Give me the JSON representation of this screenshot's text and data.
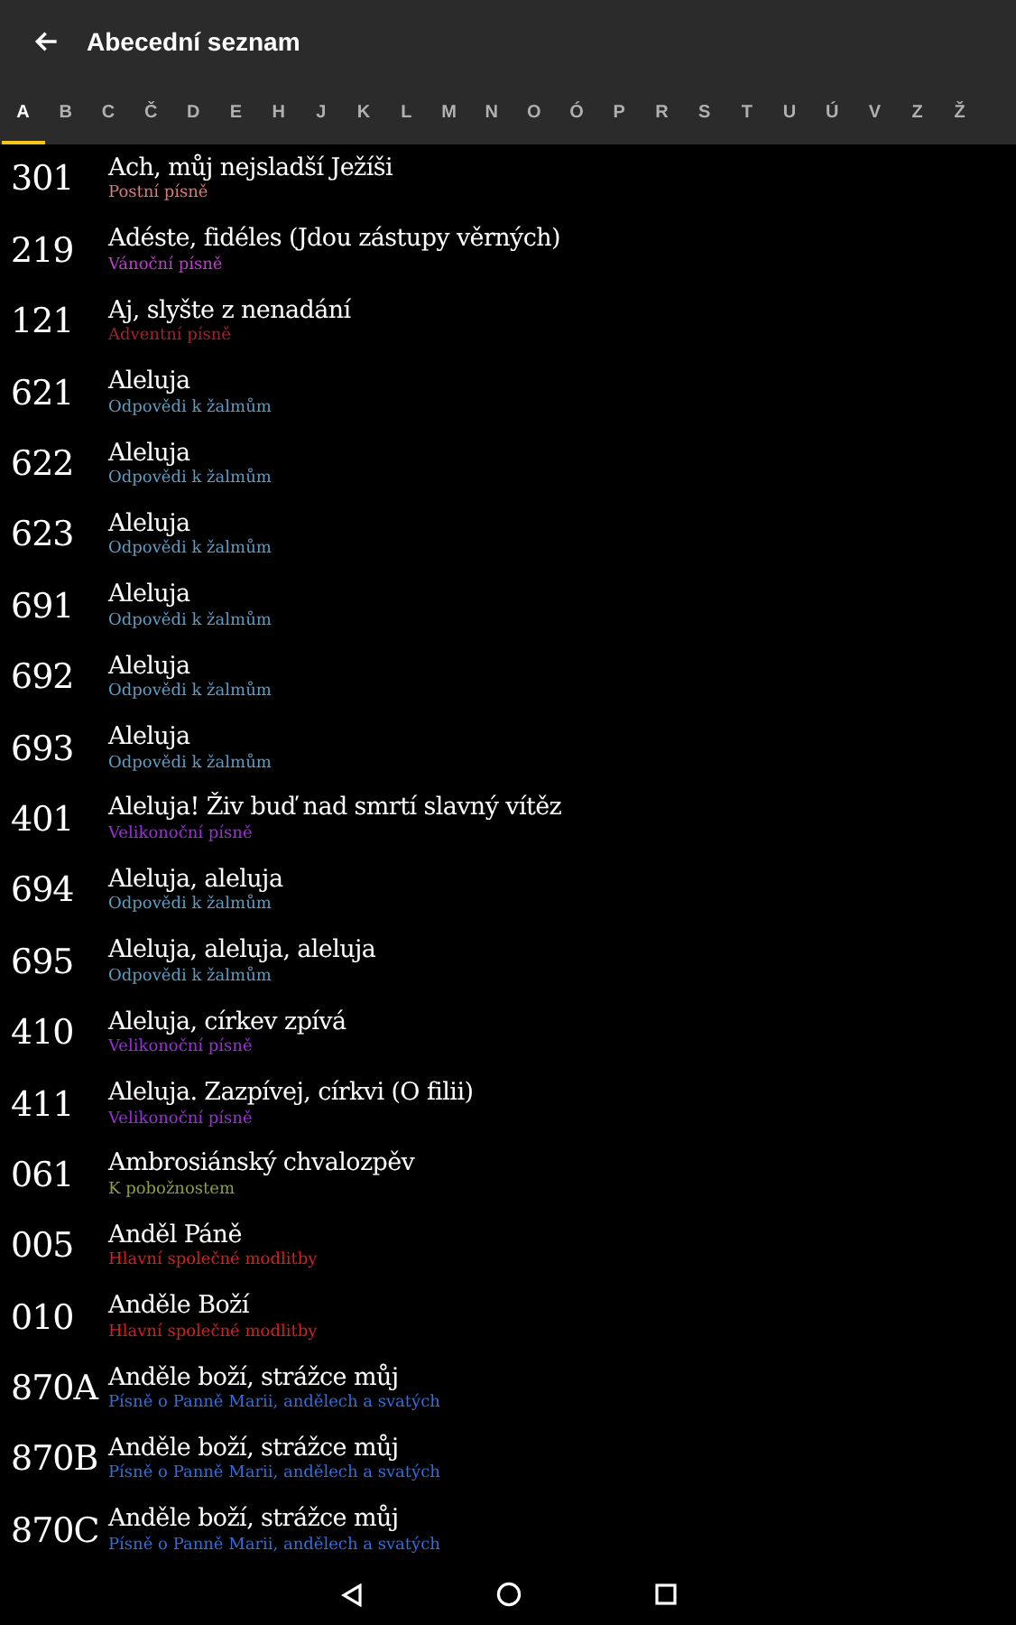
{
  "toolbar": {
    "title": "Abecední seznam"
  },
  "tabs": [
    {
      "label": "A",
      "selected": true
    },
    {
      "label": "B",
      "selected": false
    },
    {
      "label": "C",
      "selected": false
    },
    {
      "label": "Č",
      "selected": false
    },
    {
      "label": "D",
      "selected": false
    },
    {
      "label": "E",
      "selected": false
    },
    {
      "label": "H",
      "selected": false
    },
    {
      "label": "J",
      "selected": false
    },
    {
      "label": "K",
      "selected": false
    },
    {
      "label": "L",
      "selected": false
    },
    {
      "label": "M",
      "selected": false
    },
    {
      "label": "N",
      "selected": false
    },
    {
      "label": "O",
      "selected": false
    },
    {
      "label": "Ó",
      "selected": false
    },
    {
      "label": "P",
      "selected": false
    },
    {
      "label": "R",
      "selected": false
    },
    {
      "label": "S",
      "selected": false
    },
    {
      "label": "T",
      "selected": false
    },
    {
      "label": "U",
      "selected": false
    },
    {
      "label": "Ú",
      "selected": false
    },
    {
      "label": "V",
      "selected": false
    },
    {
      "label": "Z",
      "selected": false
    },
    {
      "label": "Ž",
      "selected": false
    }
  ],
  "songs": [
    {
      "number": "301",
      "title": "Ach, můj nejsladší Ježíši",
      "category": "Postní písně",
      "color": "#e07878"
    },
    {
      "number": "219",
      "title": "Adéste, fidéles (Jdou zástupy věrných)",
      "category": "Vánoční písně",
      "color": "#c23cd0"
    },
    {
      "number": "121",
      "title": "Aj, slyšte z nenadání",
      "category": "Adventní písně",
      "color": "#a8202c"
    },
    {
      "number": "621",
      "title": "Aleluja",
      "category": "Odpovědi k žalmům",
      "color": "#5a9ec6"
    },
    {
      "number": "622",
      "title": "Aleluja",
      "category": "Odpovědi k žalmům",
      "color": "#5a9ec6"
    },
    {
      "number": "623",
      "title": "Aleluja",
      "category": "Odpovědi k žalmům",
      "color": "#5a9ec6"
    },
    {
      "number": "691",
      "title": "Aleluja",
      "category": "Odpovědi k žalmům",
      "color": "#5a9ec6"
    },
    {
      "number": "692",
      "title": "Aleluja",
      "category": "Odpovědi k žalmům",
      "color": "#5a9ec6"
    },
    {
      "number": "693",
      "title": "Aleluja",
      "category": "Odpovědi k žalmům",
      "color": "#5a9ec6"
    },
    {
      "number": "401",
      "title": "Aleluja! Živ buď nad smrtí slavný vítěz",
      "category": "Velikonoční písně",
      "color": "#9a30d8"
    },
    {
      "number": "694",
      "title": "Aleluja, aleluja",
      "category": "Odpovědi k žalmům",
      "color": "#5a9ec6"
    },
    {
      "number": "695",
      "title": "Aleluja, aleluja, aleluja",
      "category": "Odpovědi k žalmům",
      "color": "#5a9ec6"
    },
    {
      "number": "410",
      "title": "Aleluja, církev zpívá",
      "category": "Velikonoční písně",
      "color": "#9a30d8"
    },
    {
      "number": "411",
      "title": "Aleluja. Zazpívej, církvi (O filii)",
      "category": "Velikonoční písně",
      "color": "#9a30d8"
    },
    {
      "number": "061",
      "title": "Ambrosiánský chvalozpěv",
      "category": "K pobožnostem",
      "color": "#8aa03c"
    },
    {
      "number": "005",
      "title": "Anděl Páně",
      "category": "Hlavní společné modlitby",
      "color": "#d42020"
    },
    {
      "number": "010",
      "title": "Anděle Boží",
      "category": "Hlavní společné modlitby",
      "color": "#d42020"
    },
    {
      "number": "870A",
      "title": "Anděle boží, strážce můj",
      "category": "Písně o Panně Marii, andělech a svatých",
      "color": "#2f6fe0"
    },
    {
      "number": "870B",
      "title": "Anděle boží, strážce můj",
      "category": "Písně o Panně Marii, andělech a svatých",
      "color": "#2f6fe0"
    },
    {
      "number": "870C",
      "title": "Anděle boží, strážce můj",
      "category": "Písně o Panně Marii, andělech a svatých",
      "color": "#2f6fe0"
    }
  ]
}
